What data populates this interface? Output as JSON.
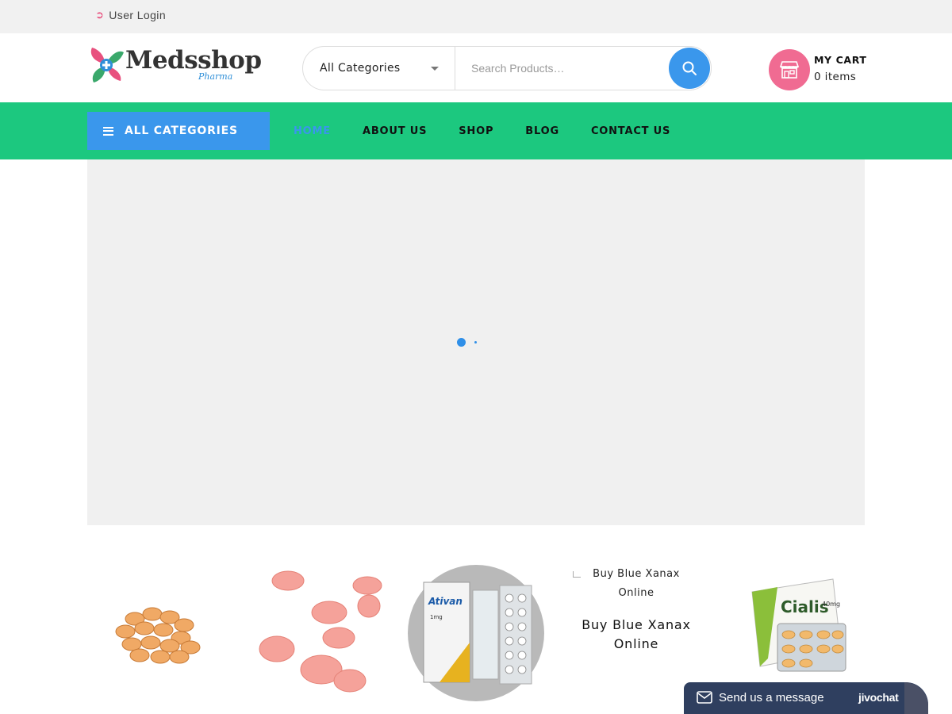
{
  "topbar": {
    "login_label": "User Login",
    "login_icon": "sign-in-icon"
  },
  "header": {
    "logo_text": "Medsshop",
    "logo_sub": "Pharma",
    "category_select": "All Categories",
    "search_placeholder": "Search Products…",
    "cart_title": "MY CART",
    "cart_count": "0 items"
  },
  "nav": {
    "all_categories": "ALL CATEGORIES",
    "links": [
      "HOME",
      "ABOUT US",
      "SHOP",
      "BLOG",
      "CONTACT US"
    ],
    "active": "HOME"
  },
  "products": {
    "alt_text": "Buy Blue Xanax Online",
    "title": "Buy Blue Xanax Online",
    "ativan_label": "Ativan",
    "ativan_dose": "1mg",
    "cialis_label": "Cialis",
    "cialis_dose": "40mg"
  },
  "chat": {
    "message": "Send us a message",
    "brand": "jivochat"
  },
  "colors": {
    "green": "#1cc87f",
    "blue": "#3a97ec",
    "pink": "#f06b92",
    "chat": "#2f3f5f"
  }
}
